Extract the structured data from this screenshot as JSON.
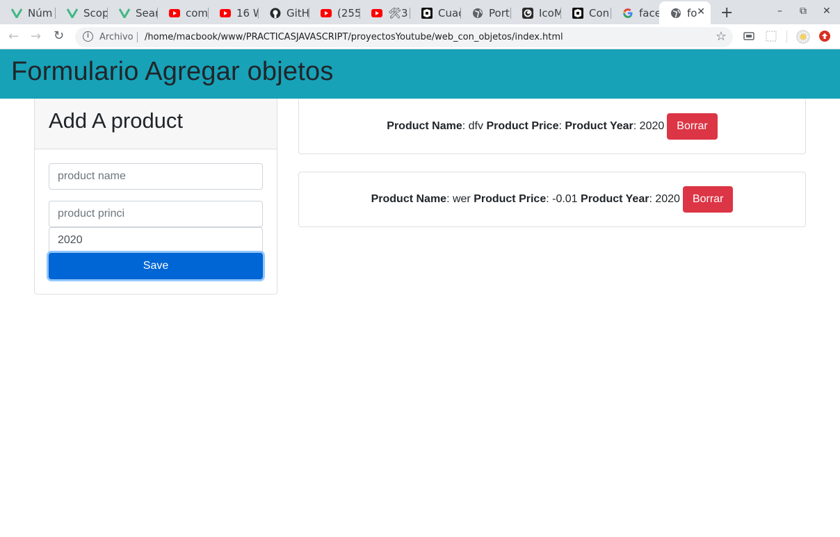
{
  "browser": {
    "tabs": [
      {
        "title": "Núm",
        "icon": "vue-icon",
        "active": false
      },
      {
        "title": "Scop",
        "icon": "vue-icon",
        "active": false
      },
      {
        "title": "Sear",
        "icon": "vue-icon",
        "active": false
      },
      {
        "title": "com",
        "icon": "youtube-icon",
        "active": false
      },
      {
        "title": "16 W",
        "icon": "youtube-icon",
        "active": false
      },
      {
        "title": "GitH",
        "icon": "github-icon",
        "active": false
      },
      {
        "title": "(255",
        "icon": "youtube-icon",
        "active": false
      },
      {
        "title": "🛠3",
        "icon": "youtube-icon",
        "active": false
      },
      {
        "title": "Cuad",
        "icon": "codepen-icon",
        "active": false
      },
      {
        "title": "Port",
        "icon": "globe-icon",
        "active": false
      },
      {
        "title": "IcoM",
        "icon": "icomoon-icon",
        "active": false
      },
      {
        "title": "Con",
        "icon": "codepen-icon",
        "active": false
      },
      {
        "title": "face",
        "icon": "google-icon",
        "active": false
      },
      {
        "title": "fo",
        "icon": "globe-icon",
        "active": true
      }
    ],
    "new_tab": "+",
    "window_controls": {
      "minimize": "–",
      "restore": "⧉",
      "close": "✕"
    },
    "address_bar": {
      "scheme_label": "Archivo",
      "url": "/home/macbook/www/PRACTICASJAVASCRIPT/proyectosYoutube/web_con_objetos/index.html"
    }
  },
  "page": {
    "title": "Formulario Agregar objetos",
    "form": {
      "header": "Add A product",
      "name_placeholder": "product name",
      "name_value": "",
      "price_placeholder": "product princi",
      "price_value": "",
      "year_value": "2020",
      "save_label": "Save"
    },
    "products": [
      {
        "name_label": "Product Name",
        "name": "dfv",
        "price_label": "Product Price",
        "price": "",
        "year_label": "Product Year",
        "year": "2020",
        "delete_label": "Borrar"
      },
      {
        "name_label": "Product Name",
        "name": "wer",
        "price_label": "Product Price",
        "price": "-0.01",
        "year_label": "Product Year",
        "year": "2020",
        "delete_label": "Borrar"
      }
    ]
  },
  "colors": {
    "navbar": "#17a2b8",
    "primary": "#0066d6",
    "danger": "#dc3545",
    "vue": "#41b883",
    "youtube": "#ff0000"
  }
}
